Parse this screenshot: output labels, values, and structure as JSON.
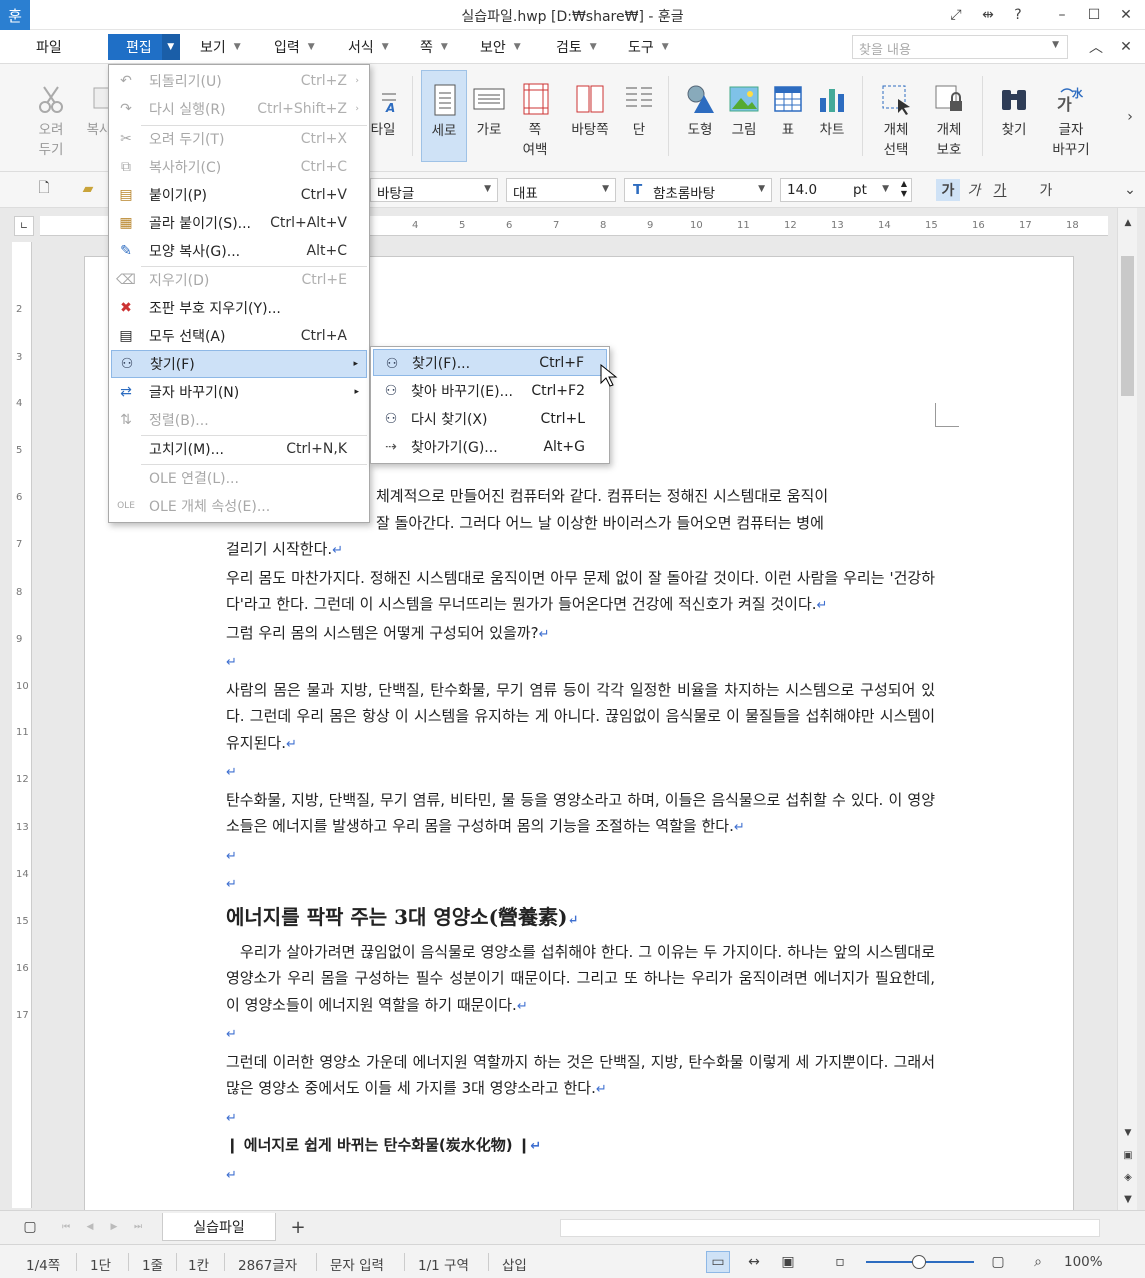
{
  "title_bar": {
    "app_icon": "훈",
    "title": "실습파일.hwp [D:₩share₩] - 훈글"
  },
  "menubar": {
    "items": [
      "파일",
      "편집",
      "보기",
      "입력",
      "서식",
      "쪽",
      "보안",
      "검토",
      "도구"
    ],
    "search_placeholder": "찾을 내용"
  },
  "ribbon": {
    "buttons": [
      "오려\n두기",
      "복사",
      "타일",
      "세로",
      "가로",
      "쪽\n여백",
      "바탕쪽",
      "단",
      "도형",
      "그림",
      "표",
      "차트",
      "개체\n선택",
      "개체\n보호",
      "찾기",
      "글자\n바꾸기"
    ]
  },
  "format_bar": {
    "style": "바탕글",
    "lang": "대표",
    "font": "함초롬바탕",
    "size": "14.0",
    "unit": "pt",
    "bold": "가",
    "italic": "가",
    "underline": "가",
    "strike": "가"
  },
  "ruler": {
    "h_ticks": [
      "4",
      "5",
      "6",
      "7",
      "8",
      "9",
      "10",
      "11",
      "12",
      "13",
      "14",
      "15",
      "16",
      "17",
      "18"
    ],
    "v_ticks": [
      "2",
      "3",
      "4",
      "5",
      "6",
      "7",
      "8",
      "9",
      "10",
      "11",
      "12",
      "13",
      "14",
      "15",
      "16",
      "17"
    ]
  },
  "edit_menu": {
    "items": [
      {
        "label": "되돌리기(U)",
        "shortcut": "Ctrl+Z",
        "disabled": true,
        "icon": "undo-icon"
      },
      {
        "label": "다시 실행(R)",
        "shortcut": "Ctrl+Shift+Z",
        "disabled": true,
        "icon": "redo-icon"
      },
      {
        "label": "오려 두기(T)",
        "shortcut": "Ctrl+X",
        "disabled": true,
        "icon": "scissors-icon"
      },
      {
        "label": "복사하기(C)",
        "shortcut": "Ctrl+C",
        "disabled": true,
        "icon": "copy-icon"
      },
      {
        "label": "붙이기(P)",
        "shortcut": "Ctrl+V",
        "disabled": false,
        "icon": "paste-icon"
      },
      {
        "label": "골라 붙이기(S)...",
        "shortcut": "Ctrl+Alt+V",
        "disabled": false,
        "icon": "paste-special-icon"
      },
      {
        "label": "모양 복사(G)...",
        "shortcut": "Alt+C",
        "disabled": false,
        "icon": "format-painter-icon"
      },
      {
        "label": "지우기(D)",
        "shortcut": "Ctrl+E",
        "disabled": true,
        "icon": "erase-icon"
      },
      {
        "label": "조판 부호 지우기(Y)...",
        "shortcut": "",
        "disabled": false,
        "icon": "delete-codes-icon"
      },
      {
        "label": "모두 선택(A)",
        "shortcut": "Ctrl+A",
        "disabled": false,
        "icon": "select-all-icon"
      },
      {
        "label": "찾기(F)",
        "shortcut": "",
        "disabled": false,
        "icon": "binoculars-icon",
        "submenu": true
      },
      {
        "label": "글자 바꾸기(N)",
        "shortcut": "",
        "disabled": false,
        "icon": "char-change-icon",
        "submenu": true
      },
      {
        "label": "정렬(B)...",
        "shortcut": "",
        "disabled": true,
        "icon": "sort-icon"
      },
      {
        "label": "고치기(M)...",
        "shortcut": "Ctrl+N,K",
        "disabled": false,
        "icon": ""
      },
      {
        "label": "OLE 연결(L)...",
        "shortcut": "",
        "disabled": true,
        "icon": ""
      },
      {
        "label": "OLE 개체 속성(E)...",
        "shortcut": "",
        "disabled": true,
        "icon": "ole-icon"
      }
    ]
  },
  "find_submenu": {
    "items": [
      {
        "label": "찾기(F)...",
        "shortcut": "Ctrl+F"
      },
      {
        "label": "찾아 바꾸기(E)...",
        "shortcut": "Ctrl+F2"
      },
      {
        "label": "다시 찾기(X)",
        "shortcut": "Ctrl+L"
      },
      {
        "label": "찾아가기(G)...",
        "shortcut": "Alt+G"
      }
    ]
  },
  "document": {
    "p1_partial": "체계적으로 만들어진 컴퓨터와 같다. 컴퓨터는 정해진 시스템대로 움직이",
    "p1_line2": "잘 돌아간다. 그러다 어느 날 이상한 바이러스가 들어오면 컴퓨터는 병에",
    "p1_line3": "걸리기 시작한다.",
    "p2": "우리 몸도 마찬가지다. 정해진 시스템대로 움직이면 아무 문제 없이 잘 돌아갈 것이다. 이런 사람을 우리는 '건강하다'라고 한다. 그런데 이 시스템을 무너뜨리는 뭔가가 들어온다면 건강에 적신호가 켜질 것이다.",
    "p3": "그럼 우리 몸의 시스템은 어떻게 구성되어 있을까?",
    "p4": "사람의 몸은 물과 지방, 단백질, 탄수화물, 무기 염류 등이 각각 일정한 비율을 차지하는 시스템으로 구성되어 있다. 그런데 우리 몸은 항상 이 시스템을 유지하는 게 아니다. 끊임없이 음식물로 이 물질들을 섭취해야만 시스템이 유지된다.",
    "p5": "탄수화물, 지방, 단백질, 무기 염류, 비타민, 물 등을 영양소라고 하며, 이들은 음식물으로 섭취할 수 있다. 이 영양소들은 에너지를 발생하고 우리 몸을 구성하며 몸의 기능을 조절하는 역할을 한다.",
    "heading": "에너지를 팍팍 주는 3대 영양소(營養素)",
    "p6": "우리가 살아가려면 끊임없이 음식물로 영양소를 섭취해야 한다. 그 이유는 두 가지이다. 하나는 앞의 시스템대로 영양소가 우리 몸을 구성하는 필수 성분이기 때문이다. 그리고 또 하나는 우리가 움직이려면 에너지가 필요한데, 이 영양소들이 에너지원 역할을 하기 때문이다.",
    "p7": "그런데 이러한 영양소 가운데 에너지원 역할까지 하는 것은 단백질, 지방, 탄수화물 이렇게 세 가지뿐이다. 그래서 많은 영양소 중에서도 이들 세 가지를 3대 영양소라고 한다.",
    "subheading": "에너지로 쉽게 바뀌는 탄수화물(炭水化物)"
  },
  "tabs": {
    "current": "실습파일",
    "add": "+"
  },
  "status_bar": {
    "page": "1/4쪽",
    "column": "1단",
    "line": "1줄",
    "col": "1칸",
    "chars": "2867글자",
    "mode": "문자 입력",
    "section": "1/1 구역",
    "insert": "삽입",
    "zoom": "100%"
  }
}
